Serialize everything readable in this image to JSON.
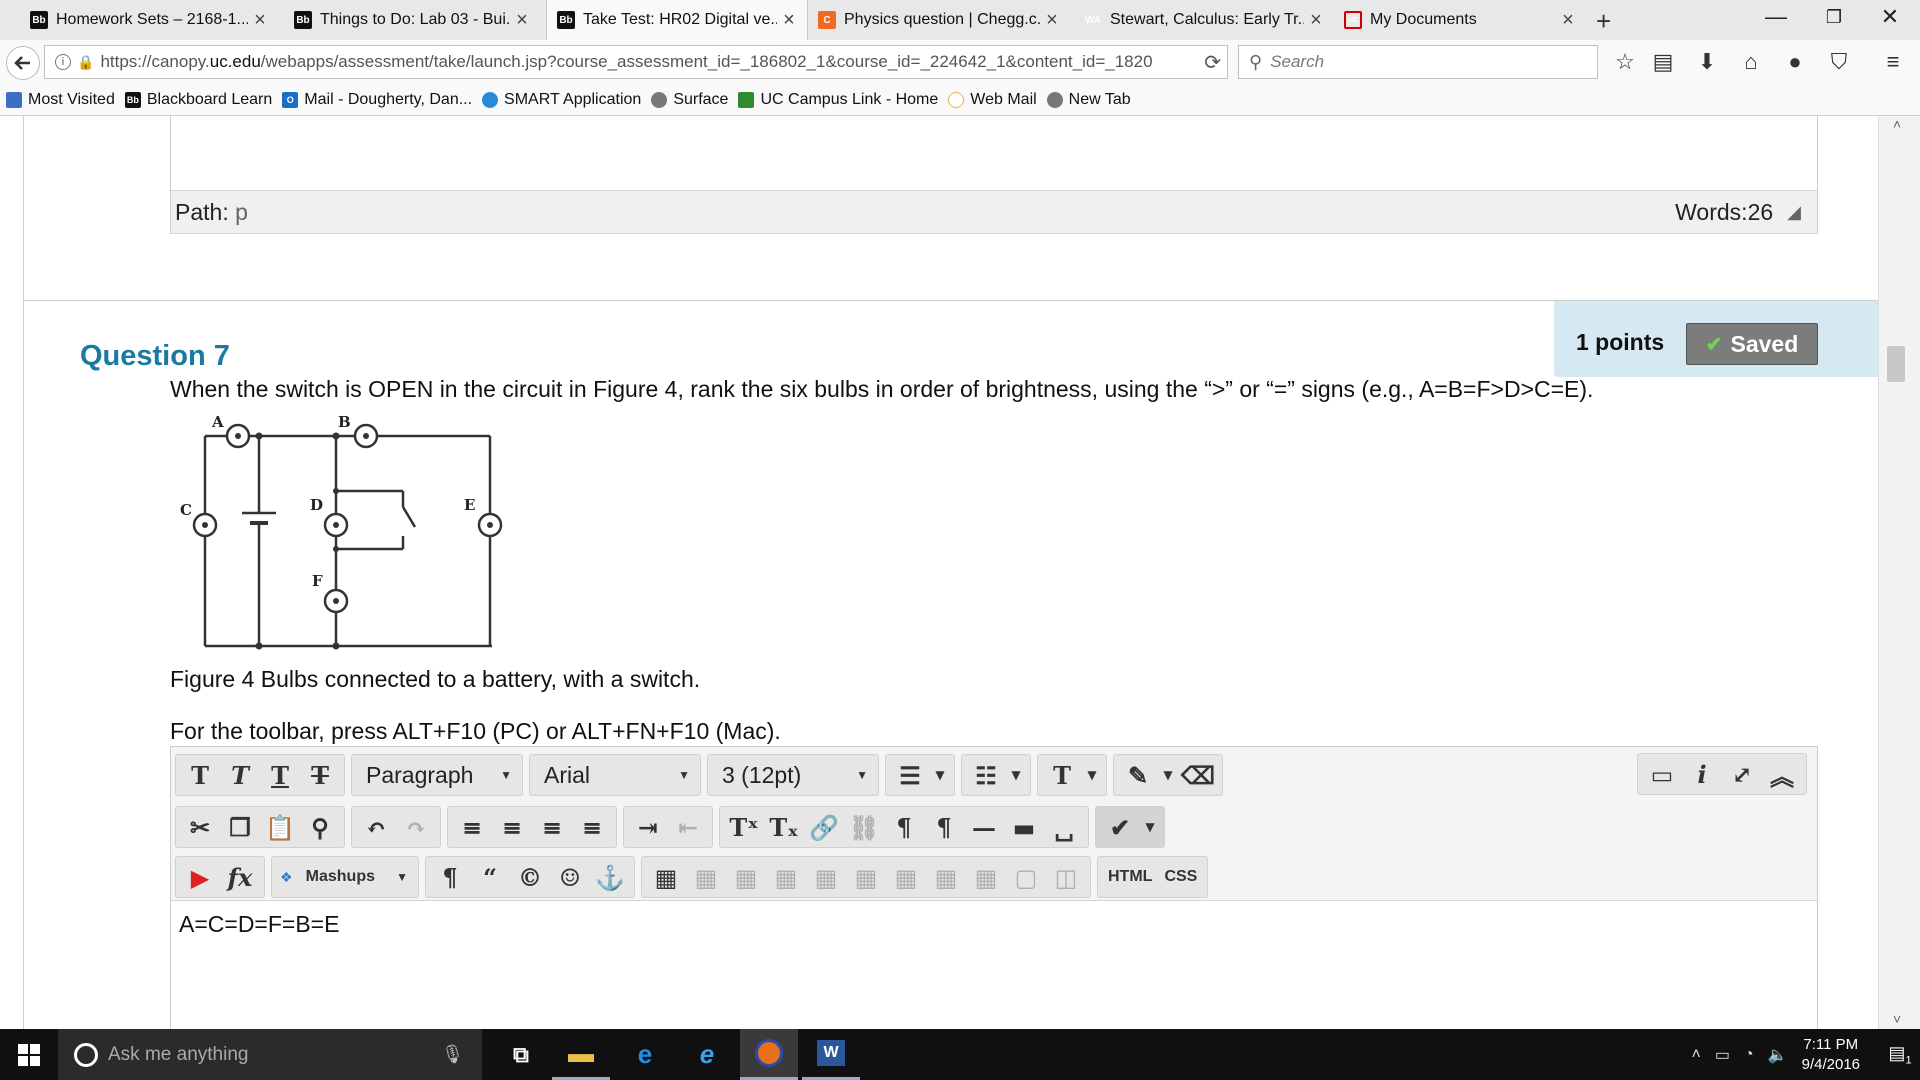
{
  "browser": {
    "tabs": [
      {
        "title": "Homework Sets – 2168-1...",
        "icon": "Bb",
        "active": false
      },
      {
        "title": "Things to Do: Lab 03 - Bui...",
        "icon": "Bb",
        "active": false
      },
      {
        "title": "Take Test: HR02 Digital ve...",
        "icon": "Bb",
        "active": true
      },
      {
        "title": "Physics question | Chegg.c...",
        "icon": "C",
        "active": false
      },
      {
        "title": "Stewart, Calculus: Early Tr...",
        "icon": "WA",
        "active": false
      },
      {
        "title": "My Documents",
        "icon": "UC",
        "active": false
      }
    ],
    "new_tab": "+",
    "window_controls": {
      "minimize": "—",
      "restore": "❐",
      "close": "✕"
    },
    "url_prefix": "https://canopy.",
    "url_domain": "uc.edu",
    "url_rest": "/webapps/assessment/take/launch.jsp?course_assessment_id=_186802_1&course_id=_224642_1&content_id=_1820",
    "search_placeholder": "Search",
    "bookmarks": [
      {
        "label": "Most Visited",
        "icon": "bookmark-folder-icon"
      },
      {
        "label": "Blackboard Learn",
        "icon": "Bb"
      },
      {
        "label": "Mail - Dougherty, Dan...",
        "icon": "O"
      },
      {
        "label": "SMART Application",
        "icon": "smart-icon"
      },
      {
        "label": "Surface",
        "icon": "globe-icon"
      },
      {
        "label": "UC Campus Link - Home",
        "icon": "campus-icon"
      },
      {
        "label": "Web Mail",
        "icon": "webmail-icon"
      },
      {
        "label": "New Tab",
        "icon": "globe-icon"
      }
    ]
  },
  "prev_editor": {
    "path_label": "Path:",
    "path_value": "p",
    "words_label": "Words:26"
  },
  "question": {
    "points": "1 points",
    "saved_label": "Saved",
    "title": "Question 7",
    "text": "When the switch is OPEN in the circuit in Figure 4, rank the six bulbs in order of brightness, using the “>” or “=” signs (e.g., A=B=F>D>C=E).",
    "figure_labels": [
      "A",
      "B",
      "C",
      "D",
      "E",
      "F"
    ],
    "figure_caption": "Figure 4 Bulbs connected to a battery, with a switch.",
    "toolbar_hint": "For the toolbar, press ALT+F10 (PC) or ALT+FN+F10 (Mac)."
  },
  "editor": {
    "paragraph_select": "Paragraph",
    "font_select": "Arial",
    "size_select": "3 (12pt)",
    "mashups_label": "Mashups",
    "html_label": "HTML",
    "css_label": "CSS",
    "content": "A=C=D=F=B=E"
  },
  "taskbar": {
    "search_placeholder": "Ask me anything",
    "time": "7:11 PM",
    "date": "9/4/2016",
    "notification_count": "1"
  },
  "colors": {
    "question_title": "#1a7aa0",
    "points_bg": "#d6e9f2",
    "saved_bg": "#7c7c7c",
    "taskbar_bg": "#101010"
  }
}
